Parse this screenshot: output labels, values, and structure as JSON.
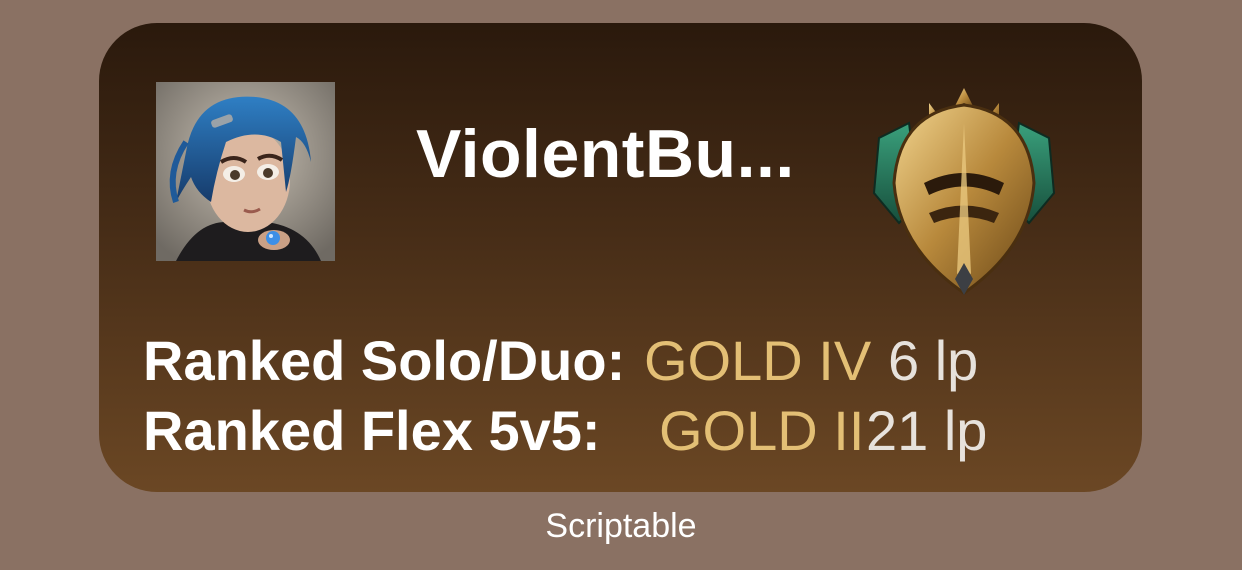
{
  "widget": {
    "summoner_name": "ViolentBu...",
    "avatar_icon": "profile-icon-blue-haired-girl",
    "rank_emblem_icon": "gold-rank-emblem-icon",
    "ranks": [
      {
        "queue": "Ranked Solo/Duo:",
        "tier": "GOLD IV",
        "lp": "6 lp"
      },
      {
        "queue": "Ranked Flex 5v5:",
        "tier": "GOLD II",
        "lp": "21 lp"
      }
    ]
  },
  "caption": "Scriptable",
  "colors": {
    "background": "#8a7163",
    "widget_top": "#2a190c",
    "widget_bottom": "#6b4724",
    "tier_gold": "#e3bf75",
    "text": "#ffffff"
  }
}
